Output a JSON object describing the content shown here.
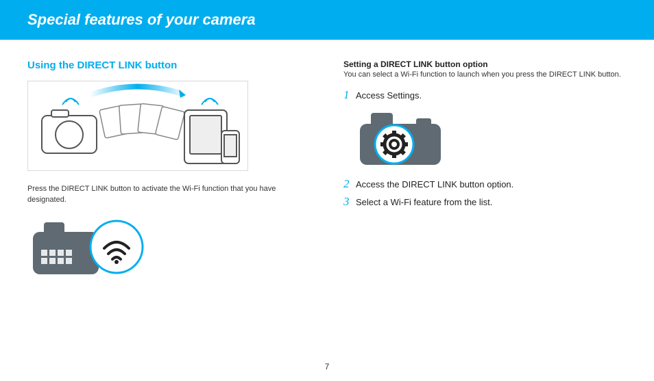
{
  "banner": {
    "title": "Special features of your camera"
  },
  "left": {
    "subhead": "Using the DIRECT LINK button",
    "caption": "Press the DIRECT LINK button to activate the Wi-Fi function that you have designated."
  },
  "right": {
    "strong": "Setting a DIRECT LINK button option",
    "desc": "You can select a Wi-Fi function to launch when you press the DIRECT LINK button.",
    "steps": {
      "n1": "1",
      "t1": "Access Settings.",
      "n2": "2",
      "t2": "Access the DIRECT LINK button option.",
      "n3": "3",
      "t3": "Select a Wi-Fi feature from the list."
    }
  },
  "pagenum": "7"
}
